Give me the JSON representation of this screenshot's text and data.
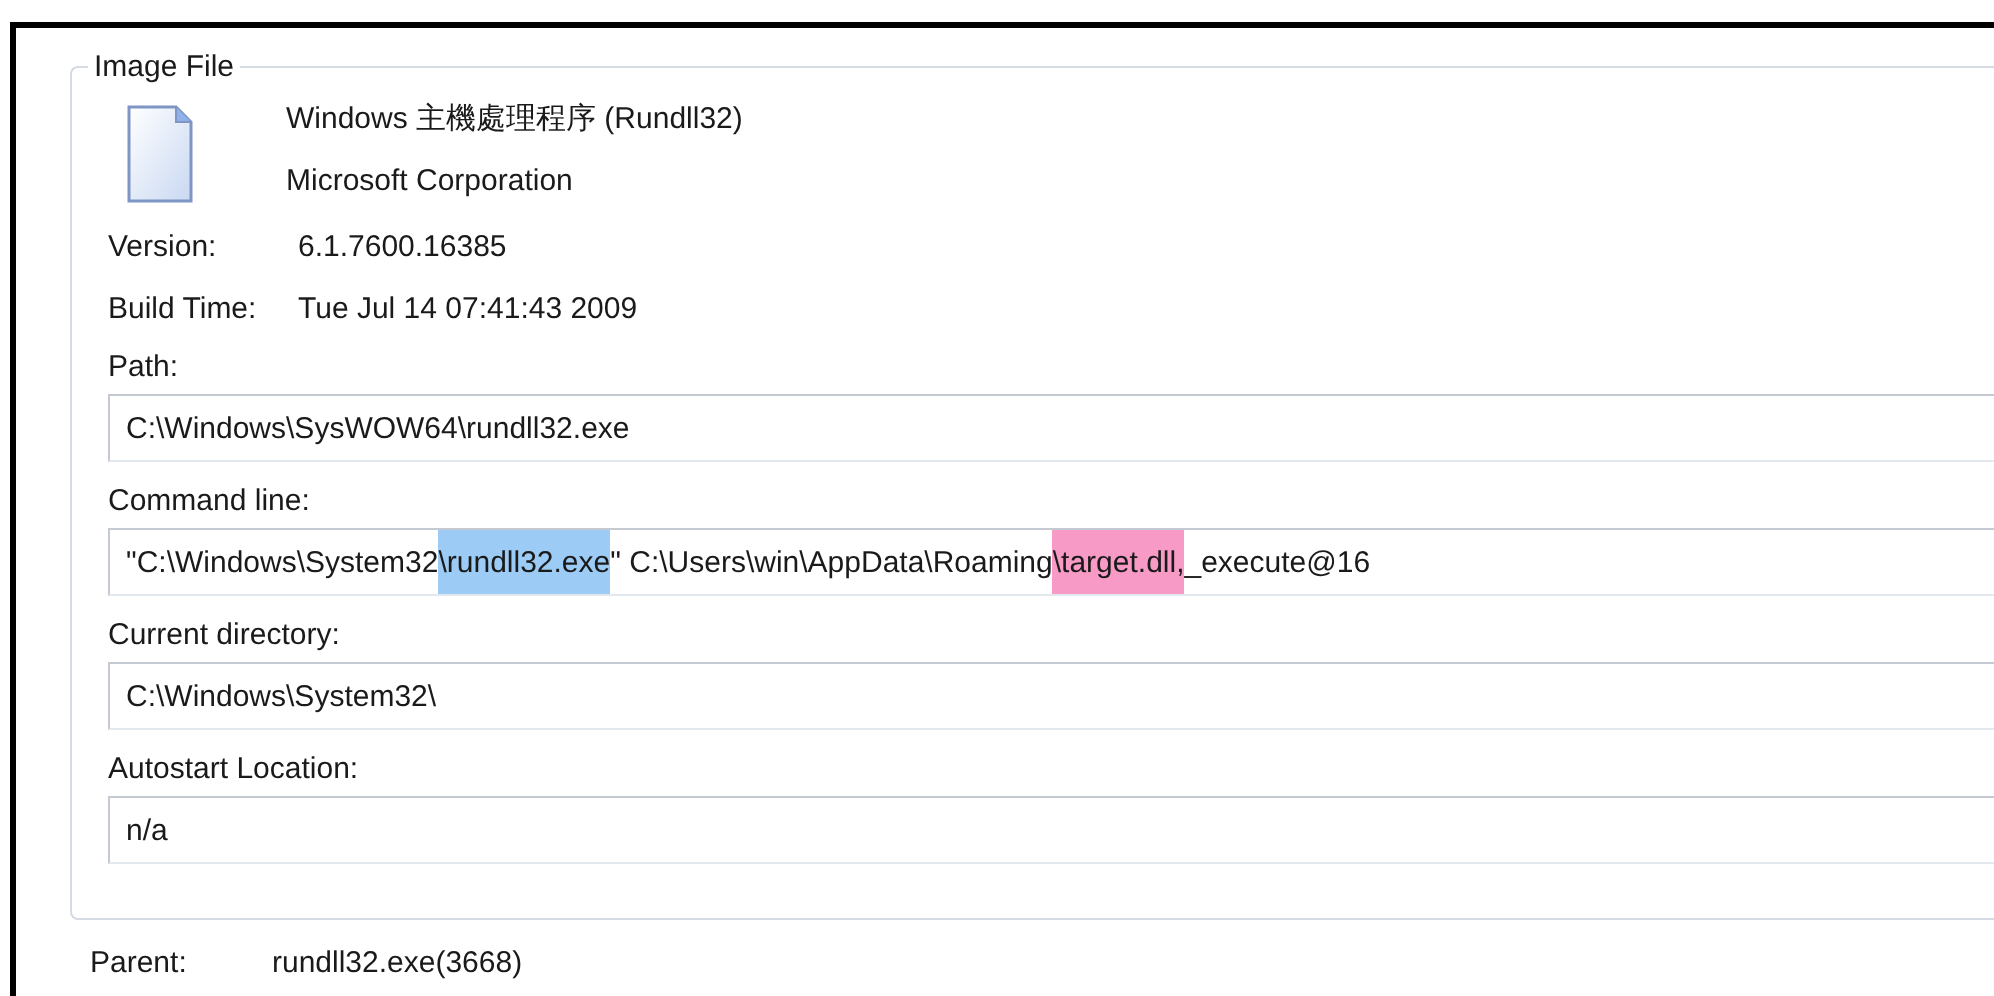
{
  "group": {
    "title": "Image File"
  },
  "description": "Windows 主機處理程序 (Rundll32)",
  "company": "Microsoft Corporation",
  "info": [
    {
      "label": "Version:",
      "value": "6.1.7600.16385"
    },
    {
      "label": "Build Time:",
      "value": "Tue Jul 14 07:41:43 2009"
    }
  ],
  "fields": [
    {
      "label": "Path:",
      "segments": [
        {
          "text": "C:\\Windows\\SysWOW64\\rundll32.exe"
        }
      ]
    },
    {
      "label": "Command line:",
      "segments": [
        {
          "text": "\"C:\\Windows\\System32"
        },
        {
          "text": "\\rundll32.exe",
          "color": "#9ccbf5"
        },
        {
          "text": "\" C:\\Users\\win\\AppData\\Roaming"
        },
        {
          "text": "\\target.dll,",
          "color": "#f79ac6"
        },
        {
          "text": "_execute@16"
        }
      ]
    },
    {
      "label": "Current directory:",
      "segments": [
        {
          "text": "C:\\Windows\\System32\\"
        }
      ]
    },
    {
      "label": "Autostart Location:",
      "segments": [
        {
          "text": "n/a"
        }
      ]
    }
  ],
  "parent": {
    "label": "Parent:",
    "value": "rundll32.exe(3668)"
  }
}
